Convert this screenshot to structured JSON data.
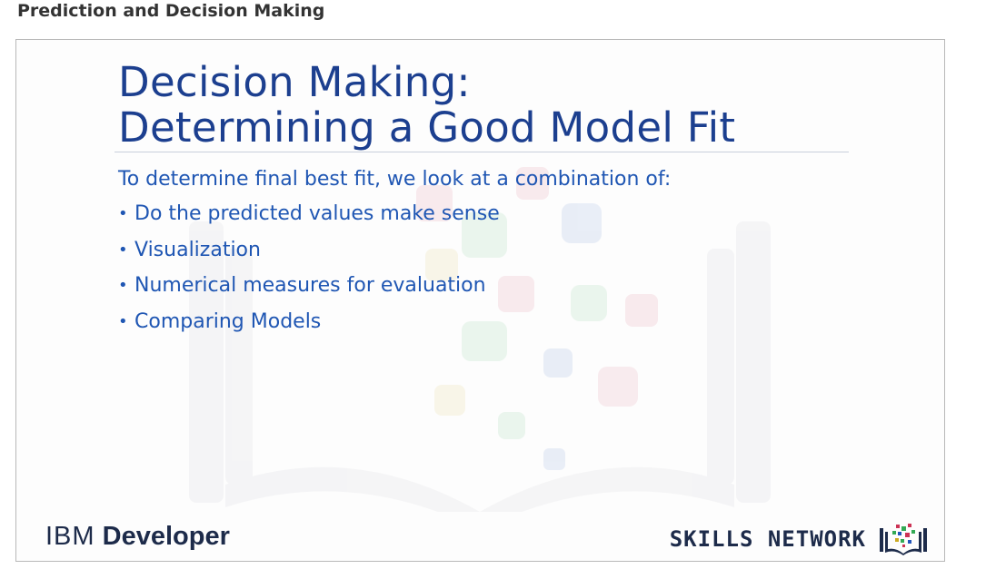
{
  "page": {
    "heading": "Prediction and Decision Making"
  },
  "slide": {
    "title_line1": "Decision Making:",
    "title_line2": "Determining a Good Model Fit",
    "intro": "To determine final best fit, we look at a combination of:",
    "bullets": [
      "Do the predicted values make sense",
      "Visualization",
      "Numerical measures for evaluation",
      "Comparing Models"
    ],
    "footer": {
      "ibm_word": "IBM",
      "developer_word": "Developer",
      "skills_network": "SKILLS NETWORK"
    }
  },
  "colors": {
    "title": "#1c3f8f",
    "body_text": "#1f56b3",
    "logo_text": "#1d2b4a",
    "slide_border": "#b8b8b8"
  },
  "icons": {
    "watermark": "book-watermark-icon",
    "skills_network_logo": "book-logo-icon",
    "bullet": "bullet-dot"
  }
}
